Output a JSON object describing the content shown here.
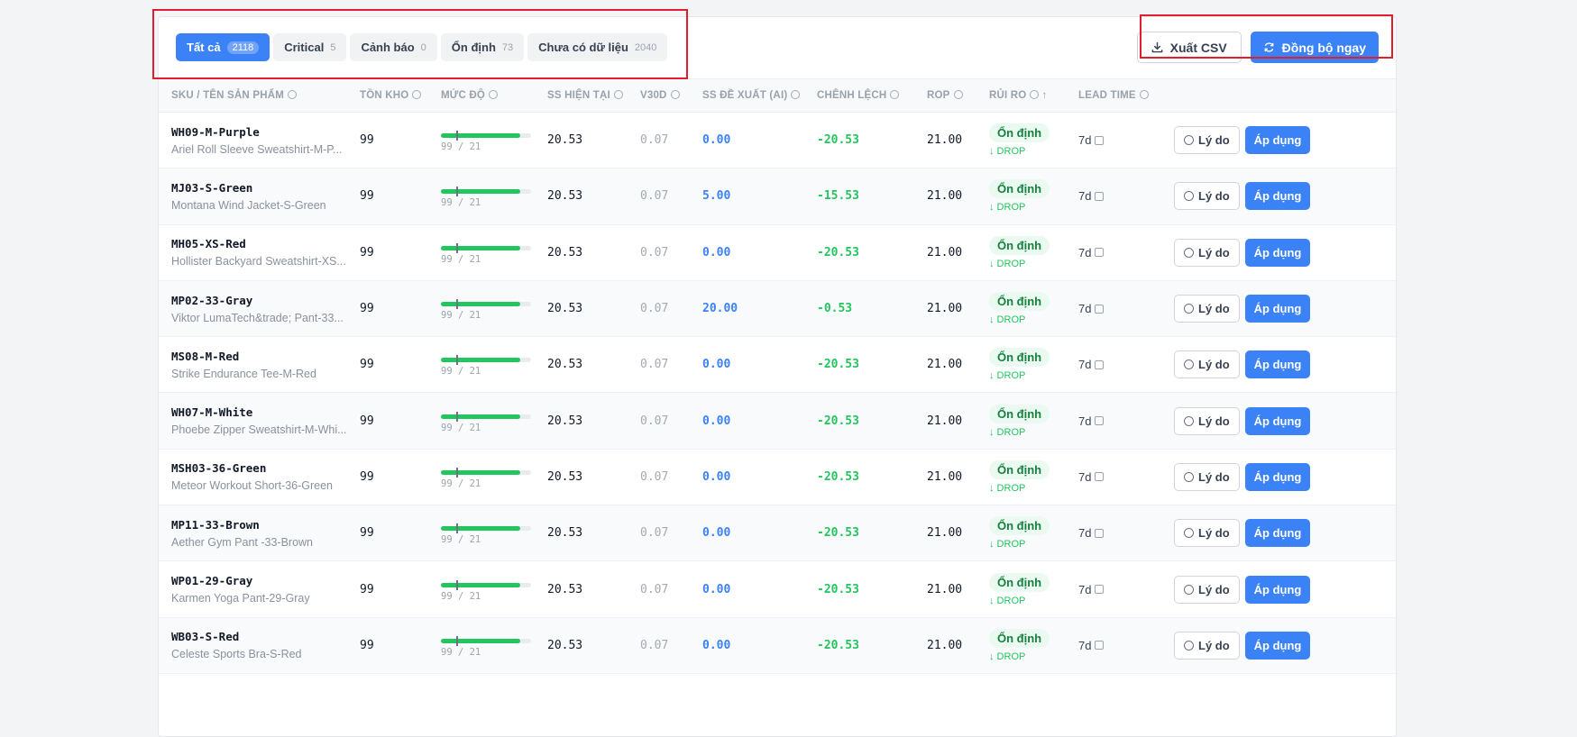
{
  "tabs": [
    {
      "label": "Tất cả",
      "count": "2118",
      "active": true
    },
    {
      "label": "Critical",
      "count": "5",
      "active": false
    },
    {
      "label": "Cảnh báo",
      "count": "0",
      "active": false
    },
    {
      "label": "Ổn định",
      "count": "73",
      "active": false
    },
    {
      "label": "Chưa có dữ liệu",
      "count": "2040",
      "active": false
    }
  ],
  "actions": {
    "export_label": "Xuất CSV",
    "sync_label": "Đồng bộ ngay"
  },
  "columns": [
    "SKU / Tên sản phẩm",
    "Tồn kho",
    "Mức độ",
    "SS hiện tại",
    "V30D",
    "SS đề xuất (AI)",
    "Chênh lệch",
    "ROP",
    "Rủi ro",
    "Lead time"
  ],
  "row_labels": {
    "status": "Ổn định",
    "drop": "↓ DROP",
    "reason": "Lý do",
    "apply": "Áp dụng"
  },
  "rows": [
    {
      "sku": "WH09-M-Purple",
      "name": "Ariel Roll Sleeve Sweatshirt-M-P...",
      "stock": "99",
      "level": "99 / 21",
      "fill": 0.88,
      "ss": "20.53",
      "v30d": "0.07",
      "ss_ai": "0.00",
      "diff": "-20.53",
      "rop": "21.00",
      "lead": "7d"
    },
    {
      "sku": "MJ03-S-Green",
      "name": "Montana Wind Jacket-S-Green",
      "stock": "99",
      "level": "99 / 21",
      "fill": 0.88,
      "ss": "20.53",
      "v30d": "0.07",
      "ss_ai": "5.00",
      "diff": "-15.53",
      "rop": "21.00",
      "lead": "7d"
    },
    {
      "sku": "MH05-XS-Red",
      "name": "Hollister Backyard Sweatshirt-XS...",
      "stock": "99",
      "level": "99 / 21",
      "fill": 0.88,
      "ss": "20.53",
      "v30d": "0.07",
      "ss_ai": "0.00",
      "diff": "-20.53",
      "rop": "21.00",
      "lead": "7d"
    },
    {
      "sku": "MP02-33-Gray",
      "name": "Viktor LumaTech&trade; Pant-33...",
      "stock": "99",
      "level": "99 / 21",
      "fill": 0.88,
      "ss": "20.53",
      "v30d": "0.07",
      "ss_ai": "20.00",
      "diff": "-0.53",
      "rop": "21.00",
      "lead": "7d"
    },
    {
      "sku": "MS08-M-Red",
      "name": "Strike Endurance Tee-M-Red",
      "stock": "99",
      "level": "99 / 21",
      "fill": 0.88,
      "ss": "20.53",
      "v30d": "0.07",
      "ss_ai": "0.00",
      "diff": "-20.53",
      "rop": "21.00",
      "lead": "7d"
    },
    {
      "sku": "WH07-M-White",
      "name": "Phoebe Zipper Sweatshirt-M-Whi...",
      "stock": "99",
      "level": "99 / 21",
      "fill": 0.88,
      "ss": "20.53",
      "v30d": "0.07",
      "ss_ai": "0.00",
      "diff": "-20.53",
      "rop": "21.00",
      "lead": "7d"
    },
    {
      "sku": "MSH03-36-Green",
      "name": "Meteor Workout Short-36-Green",
      "stock": "99",
      "level": "99 / 21",
      "fill": 0.88,
      "ss": "20.53",
      "v30d": "0.07",
      "ss_ai": "0.00",
      "diff": "-20.53",
      "rop": "21.00",
      "lead": "7d"
    },
    {
      "sku": "MP11-33-Brown",
      "name": "Aether Gym Pant -33-Brown",
      "stock": "99",
      "level": "99 / 21",
      "fill": 0.88,
      "ss": "20.53",
      "v30d": "0.07",
      "ss_ai": "0.00",
      "diff": "-20.53",
      "rop": "21.00",
      "lead": "7d"
    },
    {
      "sku": "WP01-29-Gray",
      "name": "Karmen Yoga Pant-29-Gray",
      "stock": "99",
      "level": "99 / 21",
      "fill": 0.88,
      "ss": "20.53",
      "v30d": "0.07",
      "ss_ai": "0.00",
      "diff": "-20.53",
      "rop": "21.00",
      "lead": "7d"
    },
    {
      "sku": "WB03-S-Red",
      "name": "Celeste Sports Bra-S-Red",
      "stock": "99",
      "level": "99 / 21",
      "fill": 0.88,
      "ss": "20.53",
      "v30d": "0.07",
      "ss_ai": "0.00",
      "diff": "-20.53",
      "rop": "21.00",
      "lead": "7d"
    }
  ]
}
